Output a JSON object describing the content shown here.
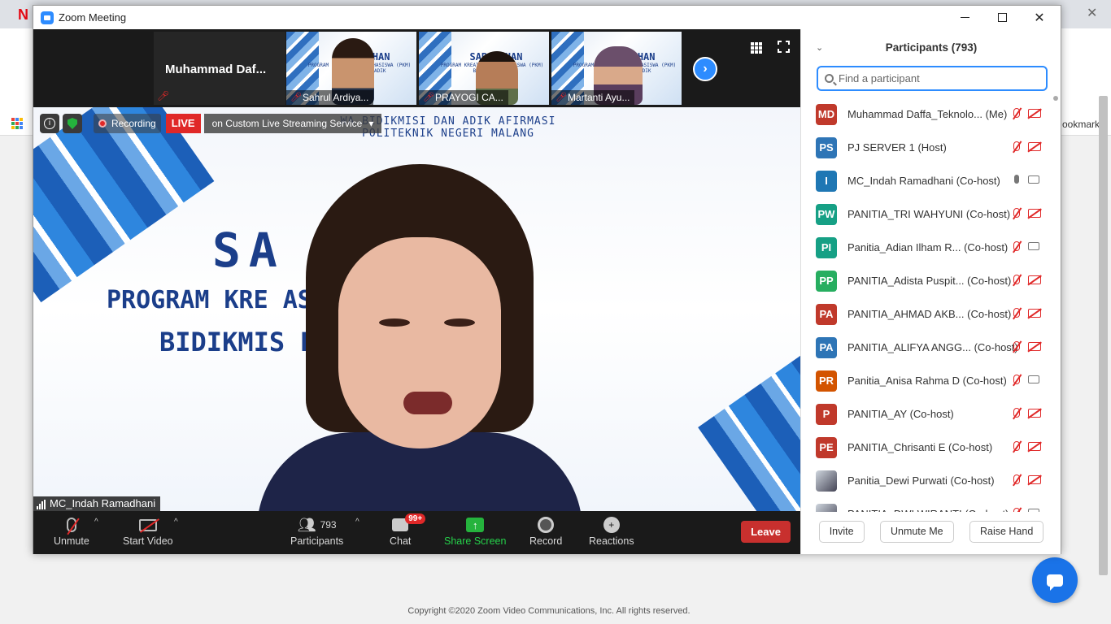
{
  "browser": {
    "logo_letter": "N",
    "close_glyph": "✕",
    "back_glyph": "←",
    "bookmarks_label": "ookmarks",
    "footer_text": "Copyright ©2020 Zoom Video Communications, Inc. All rights reserved."
  },
  "window": {
    "title": "Zoom Meeting",
    "minimize_icon": "minimize-icon",
    "maximize_icon": "maximize-icon",
    "close_glyph": "✕"
  },
  "strip": {
    "self_name": "Muhammad  Daf...",
    "thumbnails": [
      {
        "name": "Sahrul Ardiya...",
        "slide_title": "SARASEHAN",
        "slide_sub": "PROGRAM KREATIVITAS MAHASISWA (PKM) BIDIKMISI DAN ADIK"
      },
      {
        "name": "PRAYOGI CA...",
        "slide_title": "SARASEHAN",
        "slide_sub": "PROGRAM KREATIVITAS MAHASISWA (PKM) BIDIKMISI/KIP"
      },
      {
        "name": "Martanti Ayu...",
        "slide_title": "SARASEHAN",
        "slide_sub": "PROGRAM KREATIVITAS MAHASISWA (PKM) BIDIKMISI DAN ADIK"
      }
    ],
    "next_glyph": "›"
  },
  "main_video": {
    "slide_header_1": "WA BIDIKMISI DAN ADIK AFIRMASI",
    "slide_header_2": "POLITEKNIK NEGERI MALANG",
    "slide_title": "SA    HAN",
    "slide_sub_1": "PROGRAM KRE          ASISWA (PKM)",
    "slide_sub_2": "BIDIKMIS          H DAN ADIK",
    "speaker_name": "MC_Indah Ramadhani",
    "recording_label": "Recording",
    "live_label": "LIVE",
    "live_service": "on Custom Live Streaming Service",
    "dropdown_glyph": "▾"
  },
  "toolbar": {
    "unmute_label": "Unmute",
    "start_video_label": "Start Video",
    "participants_label": "Participants",
    "participants_count": "793",
    "chat_label": "Chat",
    "chat_badge": "99+",
    "share_label": "Share Screen",
    "share_glyph": "↑",
    "record_label": "Record",
    "reactions_label": "Reactions",
    "reactions_glyph": "+",
    "leave_label": "Leave",
    "caret_glyph": "^"
  },
  "participants": {
    "title": "Participants (793)",
    "collapse_glyph": "⌄",
    "search_placeholder": "Find a participant",
    "items": [
      {
        "initials": "MD",
        "color": "#c0392b",
        "name": "Muhammad Daffa_Teknolo... (Me)",
        "mic": "off",
        "cam": "off"
      },
      {
        "initials": "PS",
        "color": "#2e75b6",
        "name": "PJ SERVER 1 (Host)",
        "mic": "off",
        "cam": "off"
      },
      {
        "initials": "I",
        "color": "#1f77b4",
        "name": "MC_Indah Ramadhani (Co-host)",
        "mic": "on",
        "cam": "on"
      },
      {
        "initials": "PW",
        "color": "#16a085",
        "name": " PANITIA_TRI WAHYUNI  (Co-host)",
        "mic": "off",
        "cam": "off"
      },
      {
        "initials": "PI",
        "color": "#16a085",
        "name": "Panitia_Adian Ilham R... (Co-host)",
        "mic": "off",
        "cam": "on"
      },
      {
        "initials": "PP",
        "color": "#27ae60",
        "name": "PANITIA_Adista Puspit... (Co-host)",
        "mic": "off",
        "cam": "off"
      },
      {
        "initials": "PA",
        "color": "#c0392b",
        "name": "PANITIA_AHMAD AKB... (Co-host)",
        "mic": "off",
        "cam": "off"
      },
      {
        "initials": "PA",
        "color": "#2e75b6",
        "name": "PANITIA_ALIFYA ANGG... (Co-host)",
        "mic": "off",
        "cam": "off"
      },
      {
        "initials": "PR",
        "color": "#d35400",
        "name": "Panitia_Anisa Rahma D (Co-host)",
        "mic": "off",
        "cam": "on"
      },
      {
        "initials": "P",
        "color": "#c0392b",
        "name": "PANITIA_AY (Co-host)",
        "mic": "off",
        "cam": "off"
      },
      {
        "initials": "PE",
        "color": "#c0392b",
        "name": "PANITIA_Chrisanti E (Co-host)",
        "mic": "off",
        "cam": "off"
      },
      {
        "initials": "",
        "color": "photo",
        "name": "Panitia_Dewi Purwati (Co-host)",
        "mic": "off",
        "cam": "off"
      },
      {
        "initials": "",
        "color": "photo",
        "name": "PANITIA_DWI WIRANTI (Co-host)",
        "mic": "off",
        "cam": "on"
      }
    ],
    "invite_label": "Invite",
    "unmute_me_label": "Unmute Me",
    "raise_hand_label": "Raise Hand"
  }
}
